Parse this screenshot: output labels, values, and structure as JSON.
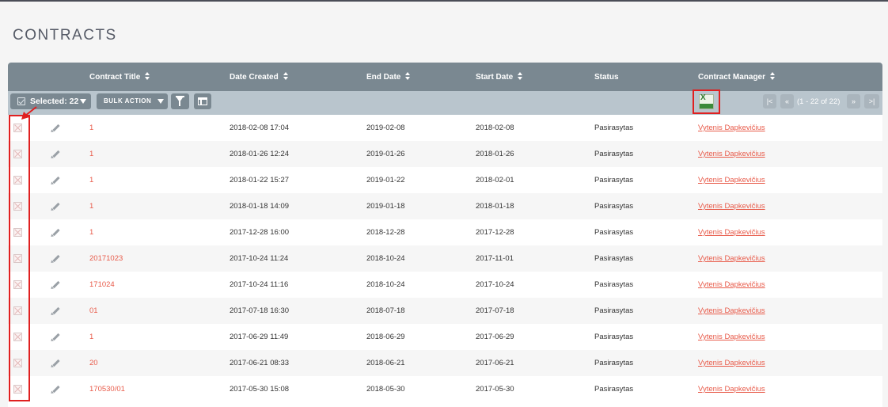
{
  "page": {
    "title": "CONTRACTS"
  },
  "columns": [
    {
      "key": "title",
      "label": "Contract Title",
      "sortable": true
    },
    {
      "key": "date_created",
      "label": "Date Created",
      "sortable": true
    },
    {
      "key": "end_date",
      "label": "End Date",
      "sortable": true
    },
    {
      "key": "start_date",
      "label": "Start Date",
      "sortable": true
    },
    {
      "key": "status",
      "label": "Status",
      "sortable": false
    },
    {
      "key": "manager",
      "label": "Contract Manager",
      "sortable": true
    }
  ],
  "toolbar": {
    "selected_label": "Selected: 22",
    "bulk_action_label": "BULK ACTION",
    "filter_icon": "filter-icon",
    "columns_icon": "columns-icon",
    "export_icon": "excel-export-icon",
    "pagination": {
      "first": "|<",
      "prev": "«",
      "info": "(1 - 22 of 22)",
      "next": "»",
      "last": ">|"
    }
  },
  "rows": [
    {
      "title": "1",
      "date_created": "2018-02-08 17:04",
      "end_date": "2019-02-08",
      "start_date": "2018-02-08",
      "status": "Pasirasytas",
      "manager": "Vytenis Dapkevičius"
    },
    {
      "title": "1",
      "date_created": "2018-01-26 12:24",
      "end_date": "2019-01-26",
      "start_date": "2018-01-26",
      "status": "Pasirasytas",
      "manager": "Vytenis Dapkevičius"
    },
    {
      "title": "1",
      "date_created": "2018-01-22 15:27",
      "end_date": "2019-01-22",
      "start_date": "2018-02-01",
      "status": "Pasirasytas",
      "manager": "Vytenis Dapkevičius"
    },
    {
      "title": "1",
      "date_created": "2018-01-18 14:09",
      "end_date": "2019-01-18",
      "start_date": "2018-01-18",
      "status": "Pasirasytas",
      "manager": "Vytenis Dapkevičius"
    },
    {
      "title": "1",
      "date_created": "2017-12-28 16:00",
      "end_date": "2018-12-28",
      "start_date": "2017-12-28",
      "status": "Pasirasytas",
      "manager": "Vytenis Dapkevičius"
    },
    {
      "title": "20171023",
      "date_created": "2017-10-24 11:24",
      "end_date": "2018-10-24",
      "start_date": "2017-11-01",
      "status": "Pasirasytas",
      "manager": "Vytenis Dapkevičius"
    },
    {
      "title": "171024",
      "date_created": "2017-10-24 11:16",
      "end_date": "2018-10-24",
      "start_date": "2017-10-24",
      "status": "Pasirasytas",
      "manager": "Vytenis Dapkevičius"
    },
    {
      "title": "01",
      "date_created": "2017-07-18 16:30",
      "end_date": "2018-07-18",
      "start_date": "2017-07-18",
      "status": "Pasirasytas",
      "manager": "Vytenis Dapkevičius"
    },
    {
      "title": "1",
      "date_created": "2017-06-29 11:49",
      "end_date": "2018-06-29",
      "start_date": "2017-06-29",
      "status": "Pasirasytas",
      "manager": "Vytenis Dapkevičius"
    },
    {
      "title": "20",
      "date_created": "2017-06-21 08:33",
      "end_date": "2018-06-21",
      "start_date": "2017-06-21",
      "status": "Pasirasytas",
      "manager": "Vytenis Dapkevičius"
    },
    {
      "title": "170530/01",
      "date_created": "2017-05-30 15:08",
      "end_date": "2018-05-30",
      "start_date": "2017-05-30",
      "status": "Pasirasytas",
      "manager": "Vytenis Dapkevičius"
    }
  ],
  "annotations": {
    "highlight_color": "#e02020"
  },
  "colors": {
    "header_bg": "#7a8891",
    "toolbar_bg": "#b9c5cd",
    "link": "#e85b4a"
  }
}
